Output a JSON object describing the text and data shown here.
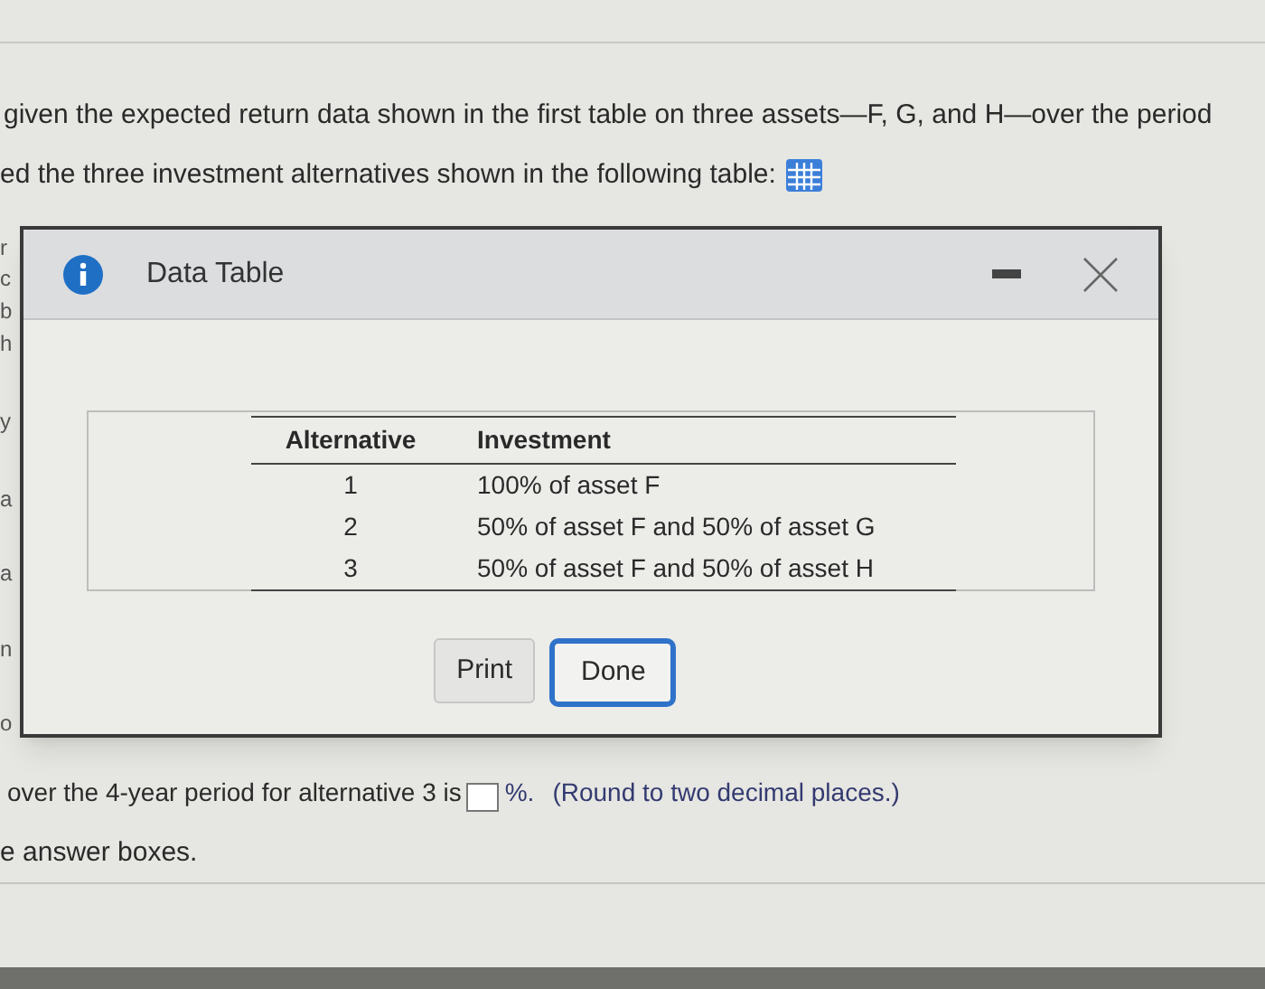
{
  "intro_lines": [
    "given the expected return data shown in the first table on three assets—F, G, and H—over the period",
    "ed the three investment alternatives shown in the following table:"
  ],
  "left_fragments": [
    "r",
    "c",
    "b",
    "h",
    "y",
    "a",
    "a",
    "n",
    "o"
  ],
  "dialog": {
    "title": "Data Table",
    "table": {
      "columns": [
        "Alternative",
        "Investment"
      ],
      "rows": [
        [
          "1",
          "100% of asset F"
        ],
        [
          "2",
          "50% of asset F and 50% of asset G"
        ],
        [
          "3",
          "50% of asset F and 50% of asset H"
        ]
      ]
    },
    "buttons": [
      {
        "label": "Print",
        "focused": false
      },
      {
        "label": "Done",
        "focused": true
      }
    ]
  },
  "question": {
    "before": "over the 4-year period for alternative 3 is",
    "after": "%.",
    "hint": "(Round to two decimal places.)"
  },
  "instruction": "e answer boxes."
}
